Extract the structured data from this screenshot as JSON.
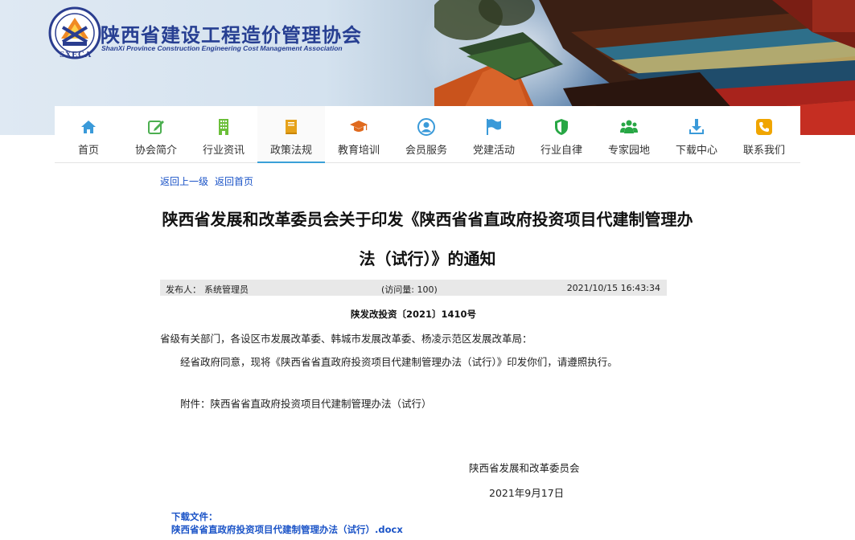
{
  "header": {
    "logo_cn": "陕西省建设工程造价管理协会",
    "logo_en": "ShanXi Province Construction Engineering Cost Management Association",
    "logo_abbr": "SXECA",
    "colors": {
      "brand_blue": "#273f92",
      "link_blue": "#1a53c7",
      "nav_active": "#3aa0d8"
    }
  },
  "nav": {
    "items": [
      {
        "label": "首页",
        "icon": "home-icon",
        "color": "#3a9ad9"
      },
      {
        "label": "协会简介",
        "icon": "edit-icon",
        "color": "#4caf50"
      },
      {
        "label": "行业资讯",
        "icon": "building-icon",
        "color": "#6cbf3a"
      },
      {
        "label": "政策法规",
        "icon": "book-icon",
        "color": "#e6a21a"
      },
      {
        "label": "教育培训",
        "icon": "graduation-cap-icon",
        "color": "#e06a1e"
      },
      {
        "label": "会员服务",
        "icon": "user-circle-icon",
        "color": "#3a9ad9"
      },
      {
        "label": "党建活动",
        "icon": "flag-icon",
        "color": "#3a9ad9"
      },
      {
        "label": "行业自律",
        "icon": "shield-icon",
        "color": "#28a745"
      },
      {
        "label": "专家园地",
        "icon": "users-icon",
        "color": "#28a745"
      },
      {
        "label": "下载中心",
        "icon": "download-icon",
        "color": "#3a9ad9"
      },
      {
        "label": "联系我们",
        "icon": "phone-icon",
        "color": "#f0a500"
      }
    ],
    "active_index": 3
  },
  "breadcrumb": {
    "back_label": "返回上一级",
    "home_label": "返回首页"
  },
  "article": {
    "title_line1": "陕西省发展和改革委员会关于印发《陕西省省直政府投资项目代建制管理办",
    "title_line2": "法（试行）》的通知",
    "author_label": "发布人：",
    "author": "系统管理员",
    "visits": "(访问量: 100)",
    "published": "2021/10/15 16:43:34",
    "doc_number": "陕发改投资〔2021〕1410号",
    "salutation": "省级有关部门，各设区市发展改革委、韩城市发展改革委、杨凌示范区发展改革局：",
    "body": "经省政府同意，现将《陕西省省直政府投资项目代建制管理办法（试行）》印发你们，请遵照执行。",
    "attachment": "附件：陕西省省直政府投资项目代建制管理办法（试行）",
    "signature": "陕西省发展和改革委员会",
    "date": "2021年9月17日"
  },
  "downloads": {
    "heading": "下载文件：",
    "file": "陕西省省直政府投资项目代建制管理办法（试行）.docx"
  }
}
